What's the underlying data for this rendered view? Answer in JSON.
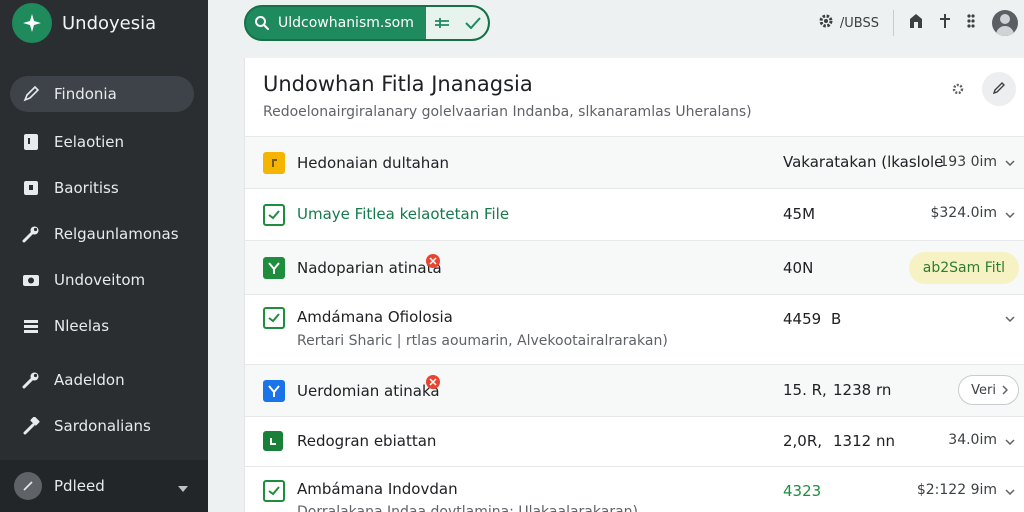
{
  "app": {
    "name": "Undoyesia"
  },
  "sidebar": {
    "items": [
      {
        "label": "Findonia",
        "icon": "pen-icon",
        "active": true
      },
      {
        "label": "Eelaotien",
        "icon": "document-icon"
      },
      {
        "label": "Baoritiss",
        "icon": "card-icon"
      },
      {
        "label": "Relgaunlamonas",
        "icon": "wrench-icon"
      },
      {
        "label": "Undoveitom",
        "icon": "camera-icon"
      },
      {
        "label": "Nleelas",
        "icon": "list-icon"
      },
      {
        "label": "Aadeldon",
        "icon": "wrench-icon"
      },
      {
        "label": "Sardonalians",
        "icon": "hammer-icon"
      }
    ],
    "footer": {
      "label": "Pdleed"
    }
  },
  "search": {
    "value": "Uldcowhanism.som"
  },
  "topbar": {
    "label": "/UBSS"
  },
  "panel": {
    "title": "Undowhan Fitla Jnanagsia",
    "subtitle": "Redoelonairgiralanary golelvaarian Indanba, slkanaramlas Uheralans)"
  },
  "rows": [
    {
      "name": "Hedonaian dultahan",
      "size": "Vakaratakan (lkaslole",
      "value": "193 0im",
      "icon": "folder-icon",
      "icon_color": "#f4b400"
    },
    {
      "name": "Umaye Fitlea  kelaotetan File",
      "size": "45M",
      "value": "$324.0im",
      "icon": "checkbox-icon",
      "icon_color": "#1e8e3e"
    },
    {
      "name": "Nadoparian atinata",
      "size": "40N",
      "pill": "ab2Sam Fitl",
      "icon": "sheet-icon",
      "icon_color": "#1e8e3e"
    },
    {
      "name": "Amdámana Ofiolosia",
      "subtitle": "Rertari Sharic | rtlas aoumarin, Alvekootairalrarakan)",
      "size": "4459",
      "extra": "B",
      "icon": "checkbox-icon",
      "icon_color": "#1e8e3e"
    },
    {
      "name": "Uerdomian atinaka",
      "size": "15. R,",
      "extra": "1238  rn",
      "pill": "Veri",
      "icon": "doc-y-icon",
      "icon_color": "#1a73e8"
    },
    {
      "name": "Redogran ebiattan",
      "size": "2,0R,",
      "extra": "1312  nn",
      "value": "34.0im",
      "icon": "sheet-icon",
      "icon_color": "#188038"
    },
    {
      "name": "Ambámana Indovdan",
      "subtitle": "Dorralakana Indaa dovtlamina: Ulakaalarakaran)",
      "size": "4323",
      "value": "$2:122 9im",
      "icon": "checkbox-icon",
      "icon_color": "#1e8e3e"
    }
  ]
}
